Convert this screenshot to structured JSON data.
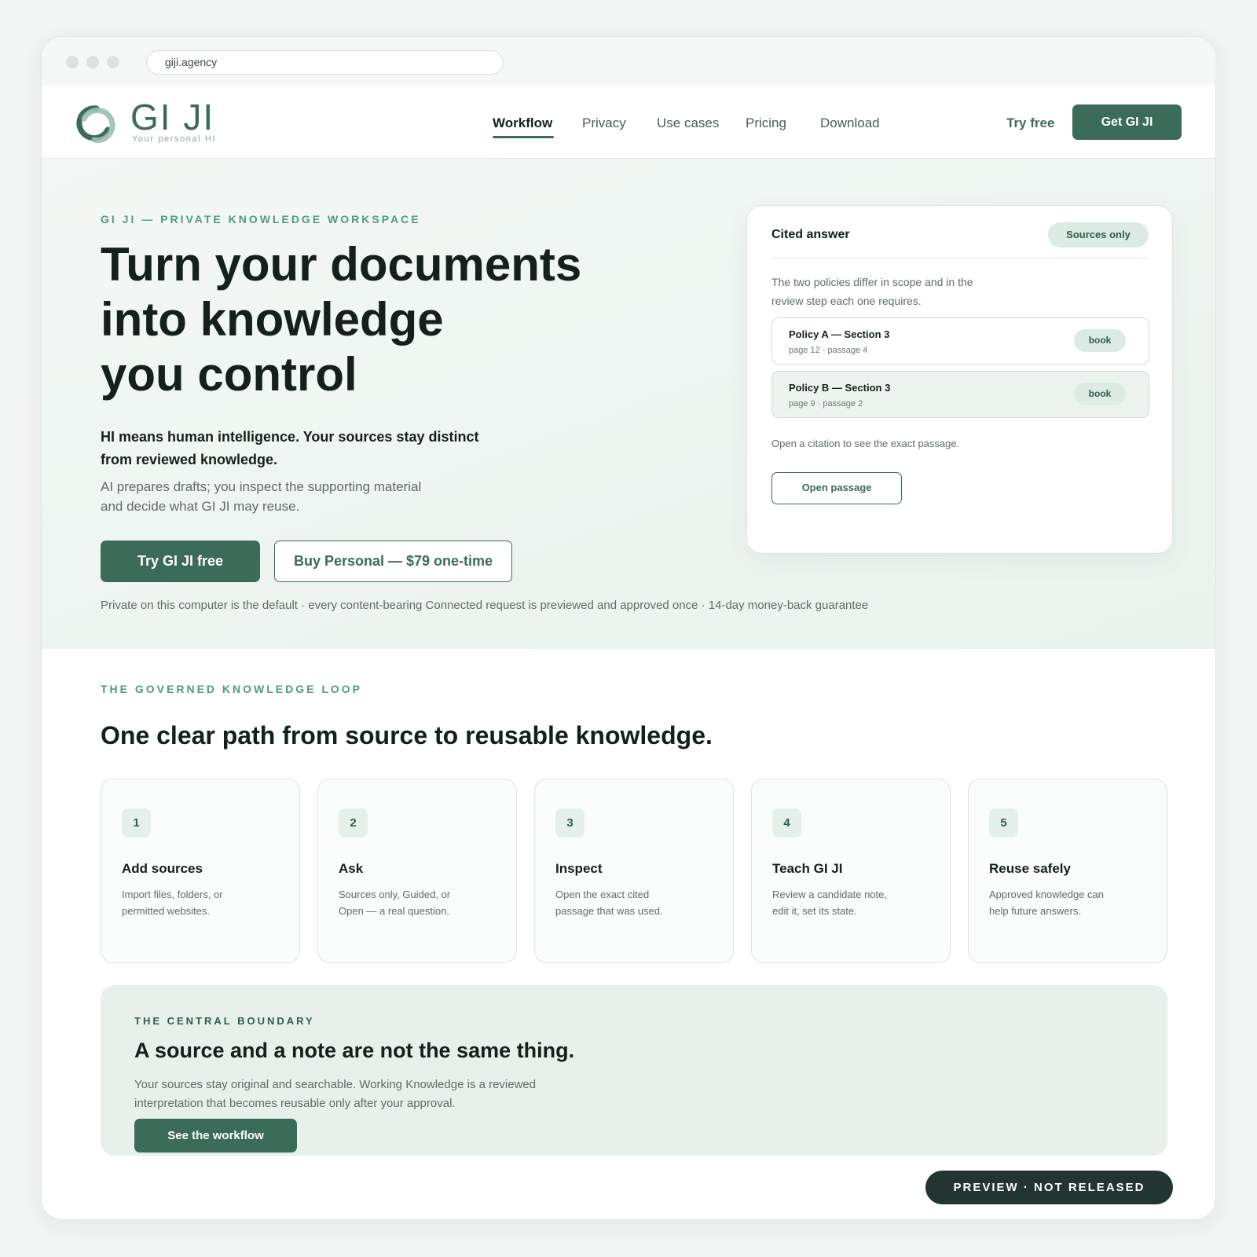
{
  "browser": {
    "url": "giji.agency"
  },
  "nav": {
    "logo_text": "GI JI",
    "logo_tagline": "Your personal HI",
    "links": [
      {
        "label": "Workflow",
        "active": true
      },
      {
        "label": "Privacy",
        "active": false
      },
      {
        "label": "Use cases",
        "active": false
      },
      {
        "label": "Pricing",
        "active": false
      },
      {
        "label": "Download",
        "active": false
      }
    ],
    "try_free": "Try free",
    "get_button": "Get GI JI"
  },
  "hero": {
    "eyebrow": "GI JI — PRIVATE KNOWLEDGE WORKSPACE",
    "title_lines": [
      "Turn your documents",
      "into knowledge",
      "you control"
    ],
    "lead_lines": [
      "HI means human intelligence. Your sources stay distinct",
      "from reviewed knowledge."
    ],
    "sub_lines": [
      "AI prepares drafts; you inspect the supporting material",
      "and decide what GI JI may reuse."
    ],
    "primary_cta": "Try GI JI free",
    "secondary_cta": "Buy Personal — $79 one-time",
    "note": "Private on this computer is the default · every content-bearing Connected request is previewed and approved once · 14-day money-back guarantee"
  },
  "answer_card": {
    "title": "Cited answer",
    "mode_pill": "Sources only",
    "text_lines": [
      "The two policies differ in scope and in the",
      "review step each one requires."
    ],
    "citations": [
      {
        "title": "Policy A — Section 3",
        "meta": "page 12 · passage 4",
        "tag": "book"
      },
      {
        "title": "Policy B — Section 3",
        "meta": "page 9 · passage 2",
        "tag": "book"
      }
    ],
    "hint": "Open a citation to see the exact passage.",
    "button": "Open passage"
  },
  "loop": {
    "eyebrow": "THE GOVERNED KNOWLEDGE LOOP",
    "title": "One clear path from source to reusable knowledge.",
    "steps": [
      {
        "num": "1",
        "title": "Add sources",
        "desc_lines": [
          "Import files, folders, or",
          "permitted websites."
        ]
      },
      {
        "num": "2",
        "title": "Ask",
        "desc_lines": [
          "Sources only, Guided, or",
          "Open — a real question."
        ]
      },
      {
        "num": "3",
        "title": "Inspect",
        "desc_lines": [
          "Open the exact cited",
          "passage that was used."
        ]
      },
      {
        "num": "4",
        "title": "Teach GI JI",
        "desc_lines": [
          "Review a candidate note,",
          "edit it, set its state."
        ]
      },
      {
        "num": "5",
        "title": "Reuse safely",
        "desc_lines": [
          "Approved knowledge can",
          "help future answers."
        ]
      }
    ]
  },
  "boundary": {
    "eyebrow": "THE CENTRAL BOUNDARY",
    "title": "A source and a note are not the same thing.",
    "text_lines": [
      "Your sources stay original and searchable. Working Knowledge is a reviewed",
      "interpretation that becomes reusable only after your approval."
    ],
    "button": "See the workflow"
  },
  "preview_badge": "PREVIEW · NOT RELEASED",
  "colors": {
    "brand": "#3b6b59",
    "accent_eyebrow": "#4f9a88",
    "hero_bg": "#eaf3ee",
    "pill_bg": "#dcebe3",
    "badge_bg": "#223530"
  }
}
